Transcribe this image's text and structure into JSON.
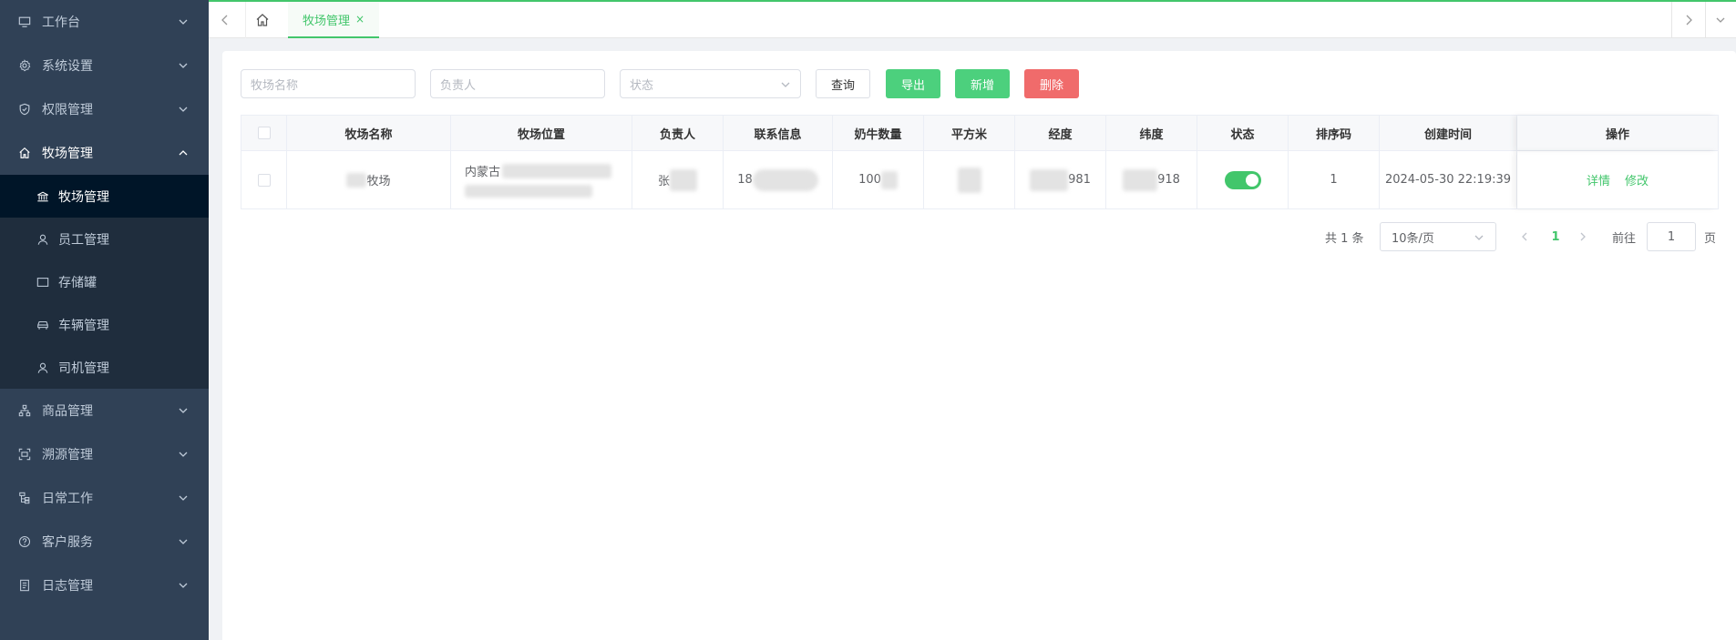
{
  "sidebar": {
    "items": [
      {
        "label": "工作台",
        "icon": "monitor-icon"
      },
      {
        "label": "系统设置",
        "icon": "gear-icon"
      },
      {
        "label": "权限管理",
        "icon": "shield-icon"
      },
      {
        "label": "牧场管理",
        "icon": "home-icon"
      },
      {
        "label": "商品管理",
        "icon": "sitemap-icon"
      },
      {
        "label": "溯源管理",
        "icon": "scan-icon"
      },
      {
        "label": "日常工作",
        "icon": "tree-icon"
      },
      {
        "label": "客户服务",
        "icon": "help-icon"
      },
      {
        "label": "日志管理",
        "icon": "document-icon"
      }
    ],
    "sub_items": [
      {
        "label": "牧场管理",
        "icon": "bank-icon"
      },
      {
        "label": "员工管理",
        "icon": "user-icon"
      },
      {
        "label": "存储罐",
        "icon": "rectangle-icon"
      },
      {
        "label": "车辆管理",
        "icon": "car-icon"
      },
      {
        "label": "司机管理",
        "icon": "user-icon"
      }
    ]
  },
  "tags": {
    "active_tab": "牧场管理",
    "close": "×"
  },
  "filters": {
    "farm_name_placeholder": "牧场名称",
    "manager_placeholder": "负责人",
    "status_placeholder": "状态"
  },
  "buttons": {
    "query": "查询",
    "export": "导出",
    "add": "新增",
    "delete": "删除"
  },
  "table": {
    "headers": [
      "牧场名称",
      "牧场位置",
      "负责人",
      "联系信息",
      "奶牛数量",
      "平方米",
      "经度",
      "纬度",
      "状态",
      "排序码",
      "创建时间",
      "操作"
    ],
    "row": {
      "farm_name_visible": "牧场",
      "location_visible": "内蒙古",
      "manager_visible": "张",
      "contact_visible": "18",
      "cow_count_visible": "100",
      "longitude_visible": "981",
      "latitude_visible": "918",
      "status_on": true,
      "sort_code": "1",
      "created_time": "2024-05-30 22:19:39",
      "op_detail": "详情",
      "op_edit": "修改"
    }
  },
  "pagination": {
    "total": "共 1 条",
    "page_size": "10条/页",
    "current_page": "1",
    "goto_label": "前往",
    "goto_value": "1",
    "page_suffix": "页"
  },
  "colors": {
    "accent": "#42c66b",
    "sidebar_bg": "#304156",
    "danger": "#f06b6b"
  }
}
